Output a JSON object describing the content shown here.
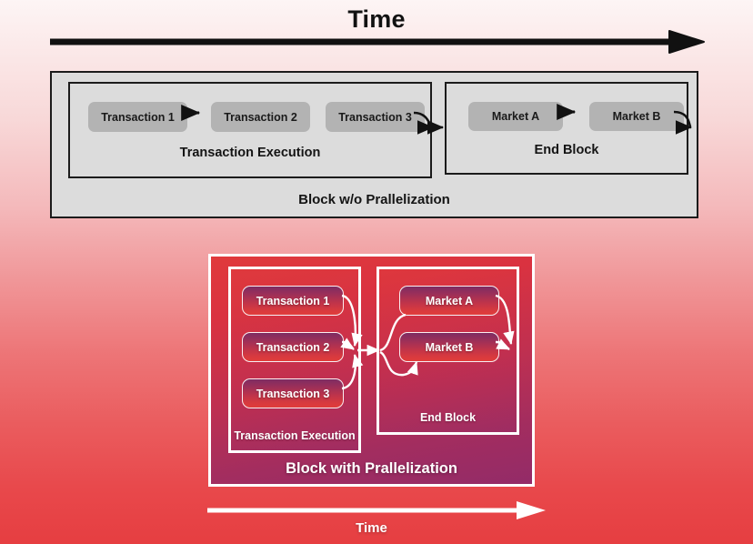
{
  "diagram": {
    "top_time_label": "Time",
    "bottom_time_label": "Time",
    "top_block": {
      "caption": "Block w/o Prallelization",
      "sections": [
        {
          "caption": "Transaction Execution",
          "nodes": [
            "Transaction 1",
            "Transaction 2",
            "Transaction 3"
          ]
        },
        {
          "caption": "End Block",
          "nodes": [
            "Market A",
            "Market B"
          ]
        }
      ]
    },
    "bottom_block": {
      "caption": "Block with Prallelization",
      "sections": [
        {
          "caption": "Transaction Execution",
          "nodes": [
            "Transaction 1",
            "Transaction 2",
            "Transaction 3"
          ]
        },
        {
          "caption": "End Block",
          "nodes": [
            "Market A",
            "Market B"
          ]
        }
      ]
    },
    "colors": {
      "background_top": "#fdf5f5",
      "background_bottom": "#e63e41",
      "top_block_fill": "#dcdcdc",
      "top_node_fill": "#b3b3b3",
      "top_stroke": "#1b1b1b",
      "bottom_stroke": "#ffffff",
      "bottom_block_fill_start": "#e03a3c",
      "bottom_block_fill_end": "#932b68"
    },
    "icons": {
      "top_time_arrow": "arrow-right-icon",
      "bottom_time_arrow": "arrow-right-icon",
      "flow_arrow": "arrow-right-icon"
    }
  }
}
